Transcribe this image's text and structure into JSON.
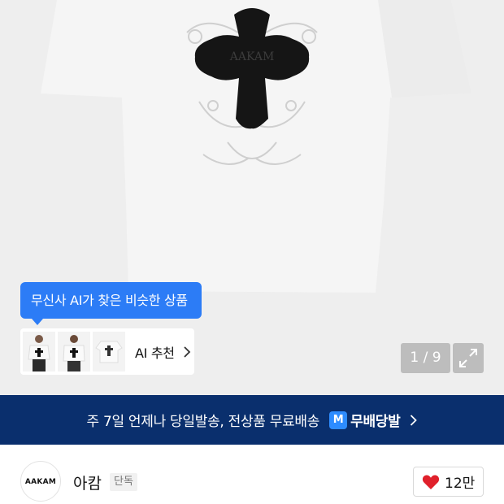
{
  "product_image": {
    "graphic_text": "AAKAM"
  },
  "ai_tooltip": {
    "text": "무신사 AI가 찾은 비슷한 상품"
  },
  "ai_recommend": {
    "label": "AI 추천",
    "thumbnails": [
      "thumb-model-front",
      "thumb-model-front-2",
      "thumb-flat-tee"
    ]
  },
  "gallery": {
    "counter": "1 / 9"
  },
  "delivery_banner": {
    "text": "주 7일 언제나 당일발송, 전상품 무료배송",
    "badge": "M",
    "brand": "무배당발"
  },
  "shop": {
    "logo_text": "AAKAM",
    "name": "아캄",
    "tag": "단독",
    "likes": "12만"
  },
  "colors": {
    "accent_blue": "#2c7cf6",
    "banner_navy": "#0a2f6d",
    "heart_red": "#e0202b"
  }
}
